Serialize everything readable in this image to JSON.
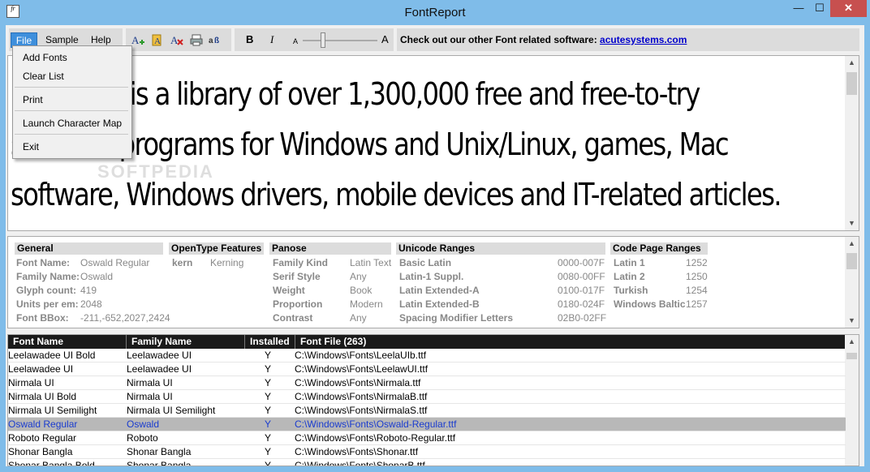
{
  "window": {
    "title": "FontReport",
    "min_glyph": "—",
    "max_glyph": "☐",
    "close_glyph": "✕",
    "app_icon_text": "fr"
  },
  "menubar": {
    "file": "File",
    "sample": "Sample",
    "help": "Help"
  },
  "file_menu": {
    "add_fonts": "Add Fonts",
    "clear_list": "Clear List",
    "print": "Print",
    "launch_charmap": "Launch Character Map",
    "exit": "Exit"
  },
  "toolbar": {
    "icons": [
      "add-font-icon",
      "add-folder-icon",
      "delete-icon",
      "print-icon",
      "charmap-icon"
    ],
    "bold_label": "B",
    "italic_label": "I",
    "size_small": "A",
    "size_large": "A",
    "size_level": 0.27
  },
  "promo": {
    "text": "Check out our other Font related software: ",
    "link": "acutesystems.com"
  },
  "sample": {
    "line1": "Softpedia is a library of over 1,300,000 free and free-to-try",
    "line2": "software programs for Windows and Unix/Linux, games, Mac",
    "line3": "software, Windows drivers, mobile devices and IT-related articles.",
    "watermark": "SOFTPEDIA"
  },
  "info": {
    "general": {
      "header": "General",
      "rows": [
        {
          "label": "Font Name:",
          "value": "Oswald Regular"
        },
        {
          "label": "Family Name:",
          "value": "Oswald"
        },
        {
          "label": "Glyph count:",
          "value": "419"
        },
        {
          "label": "Units per em:",
          "value": "2048"
        },
        {
          "label": "Font BBox:",
          "value": "-211,-652,2027,2424"
        }
      ]
    },
    "opentype": {
      "header": "OpenType Features",
      "rows": [
        {
          "label": "kern",
          "value": "Kerning"
        }
      ]
    },
    "panose": {
      "header": "Panose",
      "rows": [
        {
          "label": "Family Kind",
          "value": "Latin Text"
        },
        {
          "label": "Serif Style",
          "value": "Any"
        },
        {
          "label": "Weight",
          "value": "Book"
        },
        {
          "label": "Proportion",
          "value": "Modern"
        },
        {
          "label": "Contrast",
          "value": "Any"
        }
      ]
    },
    "unicode": {
      "header": "Unicode Ranges",
      "rows": [
        {
          "label": "Basic Latin",
          "value": "0000-007F"
        },
        {
          "label": "Latin-1 Suppl.",
          "value": "0080-00FF"
        },
        {
          "label": "Latin Extended-A",
          "value": "0100-017F"
        },
        {
          "label": "Latin Extended-B",
          "value": "0180-024F"
        },
        {
          "label": "Spacing Modifier Letters",
          "value": "02B0-02FF"
        }
      ]
    },
    "codepage": {
      "header": "Code Page Ranges",
      "rows": [
        {
          "label": "Latin 1",
          "value": "1252"
        },
        {
          "label": "Latin 2",
          "value": "1250"
        },
        {
          "label": "Turkish",
          "value": "1254"
        },
        {
          "label": "Windows Baltic",
          "value": "1257"
        }
      ]
    }
  },
  "font_list": {
    "columns": [
      "Font Name",
      "Family Name",
      "Installed",
      "Font File (263)"
    ],
    "rows": [
      {
        "name": "Leelawadee UI Bold",
        "family": "Leelawadee UI",
        "installed": "Y",
        "file": "C:\\Windows\\Fonts\\LeelaUIb.ttf"
      },
      {
        "name": "Leelawadee UI",
        "family": "Leelawadee UI",
        "installed": "Y",
        "file": "C:\\Windows\\Fonts\\LeelawUI.ttf"
      },
      {
        "name": "Nirmala UI",
        "family": "Nirmala UI",
        "installed": "Y",
        "file": "C:\\Windows\\Fonts\\Nirmala.ttf"
      },
      {
        "name": "Nirmala UI Bold",
        "family": "Nirmala UI",
        "installed": "Y",
        "file": "C:\\Windows\\Fonts\\NirmalaB.ttf"
      },
      {
        "name": "Nirmala UI Semilight",
        "family": "Nirmala UI Semilight",
        "installed": "Y",
        "file": "C:\\Windows\\Fonts\\NirmalaS.ttf"
      },
      {
        "name": "Oswald Regular",
        "family": "Oswald",
        "installed": "Y",
        "file": "C:\\Windows\\Fonts\\Oswald-Regular.ttf",
        "selected": true
      },
      {
        "name": "Roboto Regular",
        "family": "Roboto",
        "installed": "Y",
        "file": "C:\\Windows\\Fonts\\Roboto-Regular.ttf"
      },
      {
        "name": "Shonar Bangla",
        "family": "Shonar Bangla",
        "installed": "Y",
        "file": "C:\\Windows\\Fonts\\Shonar.ttf"
      },
      {
        "name": "Shonar Bangla Bold",
        "family": "Shonar Bangla",
        "installed": "Y",
        "file": "C:\\Windows\\Fonts\\ShonarB.ttf"
      }
    ]
  },
  "colors": {
    "titlebar": "#7fbce9",
    "close_button": "#c7504f",
    "menu_highlight": "#3e8fdc",
    "selected_row_text": "#1a3ccf",
    "link": "#0000cc"
  }
}
